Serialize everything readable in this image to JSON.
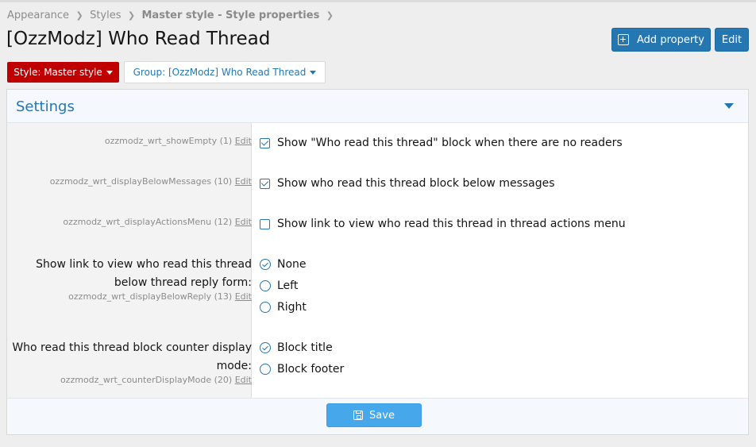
{
  "breadcrumb": [
    {
      "label": "Appearance"
    },
    {
      "label": "Styles"
    },
    {
      "label": "Master style - Style properties"
    }
  ],
  "breadcrumb_separator": "❯",
  "page_title": "[OzzModz] Who Read Thread",
  "header_buttons": {
    "add_property": "Add property",
    "edit": "Edit"
  },
  "filters": {
    "style": "Style: Master style",
    "group": "Group: [OzzModz] Who Read Thread"
  },
  "block": {
    "title": "Settings",
    "properties": {
      "show_empty": {
        "key": "ozzmodz_wrt_showEmpty (1)",
        "edit": "Edit",
        "option": "Show \"Who read this thread\" block when there are no readers",
        "checked": true
      },
      "below_messages": {
        "key": "ozzmodz_wrt_displayBelowMessages (10)",
        "edit": "Edit",
        "option": "Show who read this thread block below messages",
        "checked": true
      },
      "actions_menu": {
        "key": "ozzmodz_wrt_displayActionsMenu (12)",
        "edit": "Edit",
        "option": "Show link to view who read this thread in thread actions menu",
        "checked": false
      },
      "below_reply": {
        "label_line1": "Show link to view who read this thread",
        "label_line2": "below thread reply form:",
        "key": "ozzmodz_wrt_displayBelowReply (13)",
        "edit": "Edit",
        "options": [
          "None",
          "Left",
          "Right"
        ],
        "selected": "None"
      },
      "counter_mode": {
        "label_line1": "Who read this thread block counter display",
        "label_line2": "mode:",
        "key": "ozzmodz_wrt_counterDisplayMode (20)",
        "edit": "Edit",
        "options": [
          "Block title",
          "Block footer"
        ],
        "selected": "Block title"
      }
    },
    "save_label": "Save"
  },
  "colors": {
    "accent": "#2577b1",
    "style_filter": "#c00000",
    "save_button": "#47a7eb"
  },
  "icons": {
    "add": "plus-square-icon",
    "save": "floppy-disk-icon",
    "collapse": "caret-down-icon",
    "checkbox": "checkbox-icon",
    "radio": "radio-icon"
  }
}
